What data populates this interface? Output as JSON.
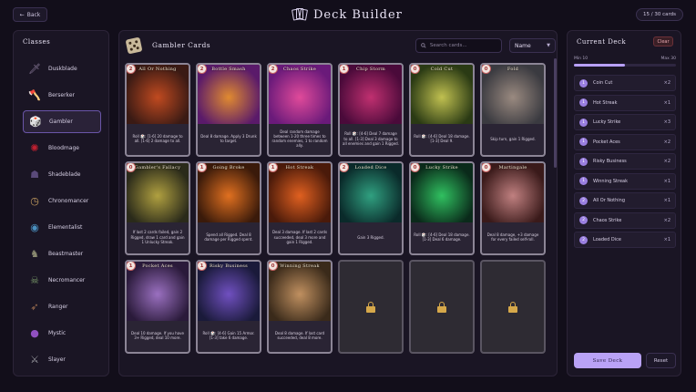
{
  "header": {
    "back_label": "Back",
    "title": "Deck Builder",
    "deck_count": "15 / 30 cards"
  },
  "classes": {
    "title": "Classes",
    "items": [
      {
        "label": "Duskblade",
        "icon": "sword-icon",
        "color": "#8a7a9a"
      },
      {
        "label": "Berserker",
        "icon": "axe-icon",
        "color": "#b05040"
      },
      {
        "label": "Gambler",
        "icon": "dice-icon",
        "color": "#c9b99a",
        "active": true
      },
      {
        "label": "Bloodmage",
        "icon": "blood-claw-icon",
        "color": "#c02030"
      },
      {
        "label": "Shadeblade",
        "icon": "hooded-figure-icon",
        "color": "#5a4a7a"
      },
      {
        "label": "Chronomancer",
        "icon": "clock-icon",
        "color": "#c8a060"
      },
      {
        "label": "Elementalist",
        "icon": "orb-icon",
        "color": "#4a90c0"
      },
      {
        "label": "Beastmaster",
        "icon": "wolf-icon",
        "color": "#8a8a70"
      },
      {
        "label": "Necromancer",
        "icon": "skull-book-icon",
        "color": "#7a9a6a"
      },
      {
        "label": "Ranger",
        "icon": "bow-icon",
        "color": "#a07050"
      },
      {
        "label": "Mystic",
        "icon": "crystal-ball-icon",
        "color": "#9050c0"
      },
      {
        "label": "Slayer",
        "icon": "blade-icon",
        "color": "#9a9aa0"
      }
    ]
  },
  "cards_section": {
    "title": "Gambler Cards",
    "search_placeholder": "Search cards...",
    "sort_value": "Name"
  },
  "cards": [
    {
      "name": "All Or Nothing",
      "cost": "2",
      "desc": "Roll 🎲: [1-6] 20 damage to all. [1-6] 2 damage to all.",
      "art": [
        "#3a1a14",
        "#c04a20"
      ]
    },
    {
      "name": "Bottle Smash",
      "cost": "2",
      "desc": "Deal 8 damage. Apply 3 Drunk to target.",
      "art": [
        "#5a1a6a",
        "#e08a30"
      ]
    },
    {
      "name": "Chaos Strike",
      "cost": "2",
      "desc": "Deal random damage between 1-20 three times to random enemies, 1 to random ally.",
      "art": [
        "#6a1a7a",
        "#e04a9a"
      ]
    },
    {
      "name": "Chip Storm",
      "cost": "1",
      "desc": "Roll 🎲: [4-6] Deal 7 damage to all. [1-3] Deal 3 damage to all enemies and gain 1 Rigged.",
      "art": [
        "#4a0a3a",
        "#c03070"
      ]
    },
    {
      "name": "Cold Cut",
      "cost": "0",
      "desc": "Roll 🎲: [4-6] Deal 18 damage. [1-3] Deal 9.",
      "art": [
        "#2a3a14",
        "#c0c050"
      ]
    },
    {
      "name": "Fold",
      "cost": "0",
      "desc": "Skip turn, gain 1 Rigged.",
      "art": [
        "#3a3a40",
        "#9a8a80"
      ]
    },
    {
      "name": "Gambler's Fallacy",
      "cost": "0",
      "desc": "If last 2 cards failed, gain 2 Rigged, draw 1 card and gain 1 Unlucky Streak.",
      "art": [
        "#2a2a1a",
        "#b0a040"
      ]
    },
    {
      "name": "Going Broke",
      "cost": "1",
      "desc": "Spend all Rigged. Deal 8 damage per Rigged spent.",
      "art": [
        "#3a1a0a",
        "#e07020"
      ]
    },
    {
      "name": "Hot Streak",
      "cost": "1",
      "desc": "Deal 3 damage. If last 2 cards succeeded, deal 3 more and gain 1 Rigged.",
      "art": [
        "#4a1a0a",
        "#e06020"
      ]
    },
    {
      "name": "Loaded Dice",
      "cost": "2",
      "desc": "Gain 3 Rigged.",
      "art": [
        "#0a2a2a",
        "#30a080"
      ]
    },
    {
      "name": "Lucky Strike",
      "cost": "0",
      "desc": "Roll 🎲: [4-6] Deal 18 damage. [1-3] Deal 6 damage.",
      "art": [
        "#0a2a1a",
        "#30c060"
      ]
    },
    {
      "name": "Martingale",
      "cost": "0",
      "desc": "Deal 8 damage, +3 damage for every failed self-roll.",
      "art": [
        "#3a1a1a",
        "#c08080"
      ]
    },
    {
      "name": "Pocket Aces",
      "cost": "1",
      "desc": "Deal 10 damage. If you have 3+ Rigged, deal 10 more.",
      "art": [
        "#2a1a3a",
        "#9a70c0"
      ]
    },
    {
      "name": "Risky Business",
      "cost": "1",
      "desc": "Roll 🎲: [4-6] Gain 15 Armor. [1-3] take 6 damage.",
      "art": [
        "#1a1a3a",
        "#7050c0"
      ]
    },
    {
      "name": "Winning Streak",
      "cost": "0",
      "desc": "Deal 8 damage. If last card succeeded, deal 8 more.",
      "art": [
        "#3a2a1a",
        "#c09060"
      ]
    }
  ],
  "locked_slots": 3,
  "deck": {
    "title": "Current Deck",
    "clear_label": "Clear",
    "min_label": "Min 10",
    "max_label": "Max 30",
    "progress_fraction": 0.5,
    "items": [
      {
        "cost": "1",
        "name": "Coin Cut",
        "qty": "×2"
      },
      {
        "cost": "1",
        "name": "Hot Streak",
        "qty": "×1"
      },
      {
        "cost": "1",
        "name": "Lucky Strike",
        "qty": "×3"
      },
      {
        "cost": "1",
        "name": "Pocket Aces",
        "qty": "×2"
      },
      {
        "cost": "1",
        "name": "Risky Business",
        "qty": "×2"
      },
      {
        "cost": "1",
        "name": "Winning Streak",
        "qty": "×1"
      },
      {
        "cost": "2",
        "name": "All Or Nothing",
        "qty": "×1"
      },
      {
        "cost": "2",
        "name": "Chaos Strike",
        "qty": "×2"
      },
      {
        "cost": "2",
        "name": "Loaded Dice",
        "qty": "×1"
      }
    ],
    "save_label": "Save Deck",
    "reset_label": "Reset"
  }
}
